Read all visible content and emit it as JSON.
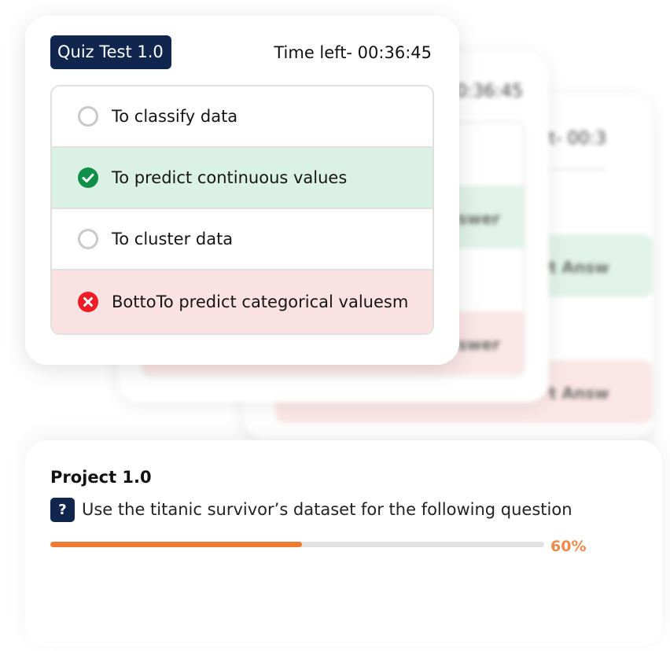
{
  "quiz": {
    "badge_label": "Quiz Test 1.0",
    "timer_label": "Time left- 00:36:45",
    "options": [
      {
        "label": "To classify data",
        "state": "unselected",
        "icon": "radio-empty-icon"
      },
      {
        "label": "To predict continuous values",
        "state": "correct",
        "icon": "check-circle-icon"
      },
      {
        "label": "To cluster data",
        "state": "unselected",
        "icon": "radio-empty-icon"
      },
      {
        "label": "BottoTo predict categorical valuesm",
        "state": "wrong",
        "icon": "x-circle-icon"
      }
    ]
  },
  "background_cards": {
    "card2_timer": "0:36:45",
    "card2_option_a": "swer",
    "card2_option_b": "swer",
    "card3_timer": "t- 00:3",
    "card3_option_a": "t Answ",
    "card3_option_b": "t Answ"
  },
  "project": {
    "title": "Project 1.0",
    "question_icon_label": "?",
    "question": "Use the titanic survivor’s dataset for the following question",
    "progress_percent": 60,
    "progress_label": "60%"
  },
  "colors": {
    "navy": "#11264f",
    "correct_bg": "#dcf1e5",
    "correct_icon": "#0f8f47",
    "wrong_bg": "#fbe2e2",
    "wrong_icon": "#ee1c25",
    "progress": "#ef7a32",
    "progress_text": "#ef8a4d"
  }
}
